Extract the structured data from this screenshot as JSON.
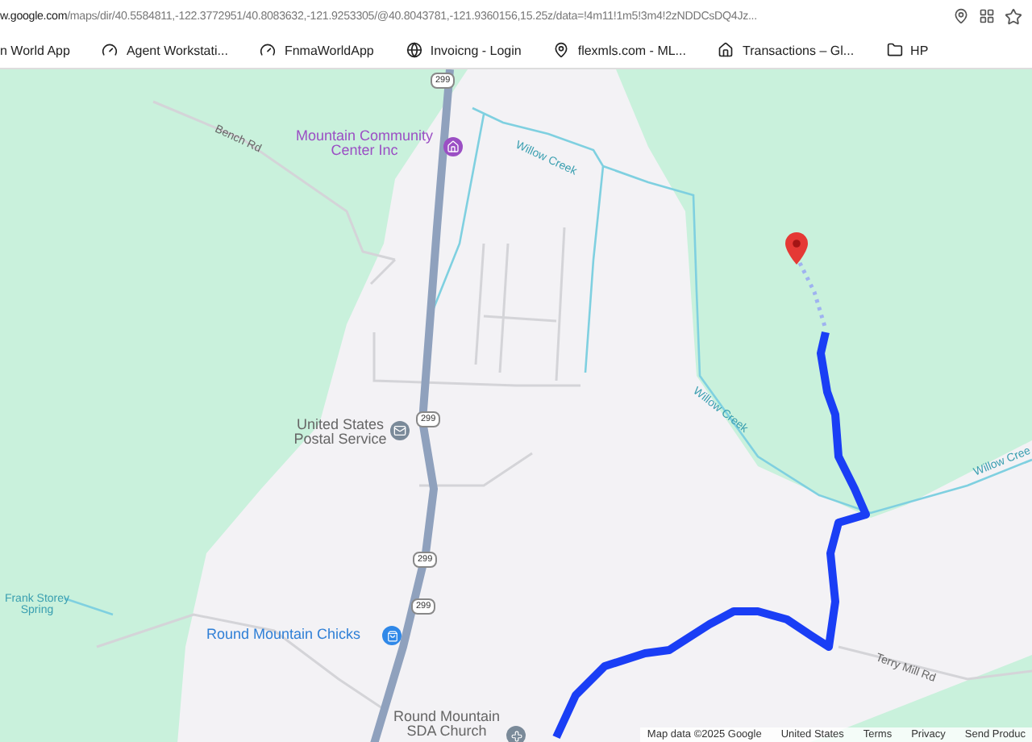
{
  "address_bar": {
    "host": "w.google.com",
    "path": "/maps/dir/40.5584811,-122.3772951/40.8083632,-121.9253305/@40.8043781,-121.9360156,15.25z/data=!4m11!1m5!3m4!2zNDDCsDQ4Jz..."
  },
  "bookmarks": [
    {
      "label": "n World App"
    },
    {
      "label": "Agent Workstati..."
    },
    {
      "label": "FnmaWorldApp"
    },
    {
      "label": "Invoicng - Login"
    },
    {
      "label": "flexmls.com - ML..."
    },
    {
      "label": "Transactions – Gl..."
    },
    {
      "label": "HP"
    }
  ],
  "map": {
    "labels": [
      {
        "text": "Bench Rd",
        "kind": "road"
      },
      {
        "text": "Mountain Community Center Inc",
        "kind": "community"
      },
      {
        "text": "Willow Creek",
        "kind": "water"
      },
      {
        "text": "United States Postal Service",
        "kind": "place"
      },
      {
        "text": "Willow Creek",
        "kind": "water"
      },
      {
        "text": "Willow Cree",
        "kind": "water"
      },
      {
        "text": "Frank Storey Spring",
        "kind": "water"
      },
      {
        "text": "Round Mountain Chicks",
        "kind": "shop"
      },
      {
        "text": "Terry Mill Rd",
        "kind": "road"
      },
      {
        "text": "Round Mountain SDA Church",
        "kind": "place"
      }
    ],
    "shields": [
      "299",
      "299",
      "299",
      "299"
    ]
  },
  "footer": [
    "Map data ©2025 Google",
    "United States",
    "Terms",
    "Privacy",
    "Send Produc"
  ]
}
